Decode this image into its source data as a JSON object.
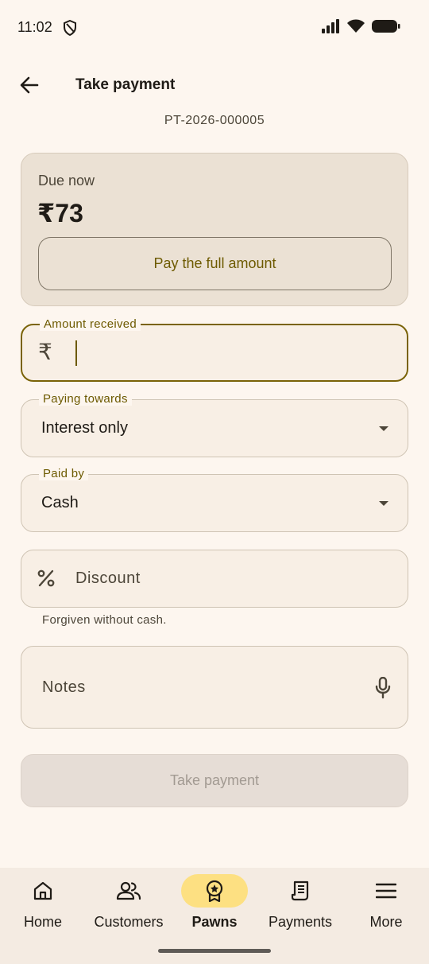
{
  "status_bar": {
    "time": "11:02"
  },
  "app_bar": {
    "title": "Take payment"
  },
  "pawn_id": "PT-2026-000005",
  "due_card": {
    "label": "Due now",
    "amount": "₹73",
    "full_amount_button": "Pay the full amount"
  },
  "amount_field": {
    "label": "Amount received",
    "prefix": "₹",
    "value": ""
  },
  "paying_towards": {
    "label": "Paying towards",
    "value": "Interest only"
  },
  "paid_by": {
    "label": "Paid by",
    "value": "Cash"
  },
  "discount": {
    "placeholder": "Discount",
    "helper": "Forgiven without cash.",
    "icon": "percent-icon"
  },
  "notes": {
    "placeholder": "Notes",
    "icon": "mic-icon"
  },
  "submit_button": "Take payment",
  "bottom_nav": {
    "items": [
      {
        "label": "Home",
        "icon": "home-icon",
        "active": false
      },
      {
        "label": "Customers",
        "icon": "people-icon",
        "active": false
      },
      {
        "label": "Pawns",
        "icon": "badge-icon",
        "active": true
      },
      {
        "label": "Payments",
        "icon": "receipt-icon",
        "active": false
      },
      {
        "label": "More",
        "icon": "menu-icon",
        "active": false
      }
    ]
  },
  "colors": {
    "accent": "#6d5a00",
    "active_nav": "#fde082",
    "background": "#fdf6ef",
    "card": "#ebe1d4"
  }
}
